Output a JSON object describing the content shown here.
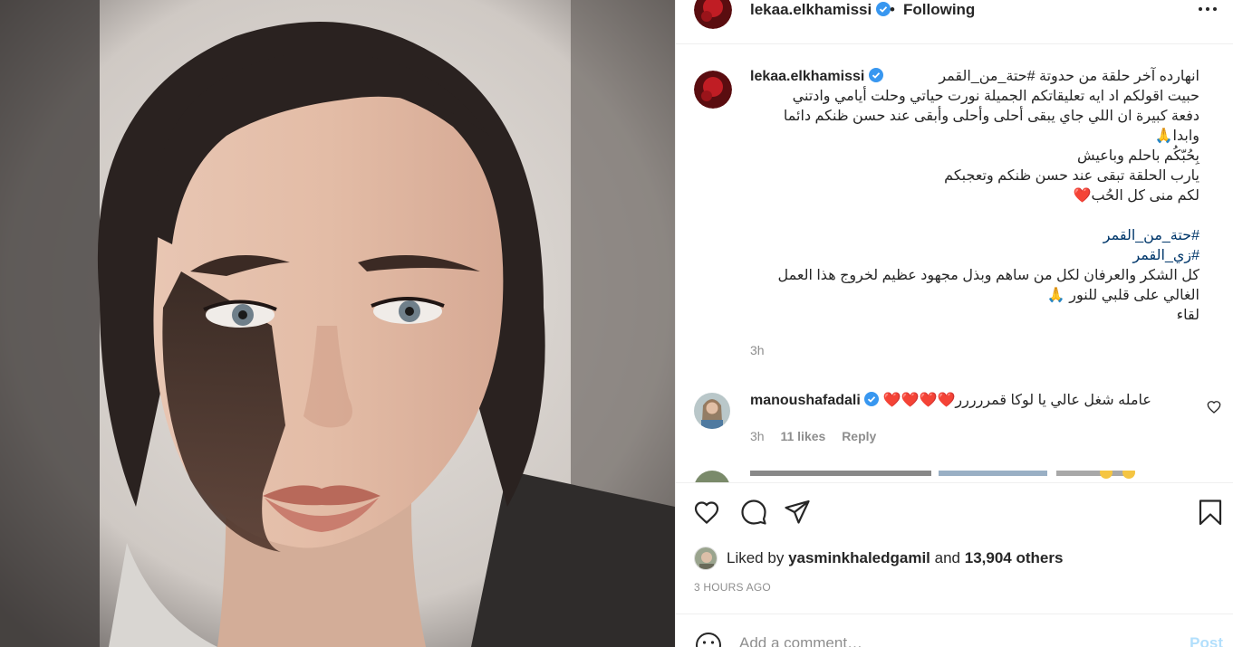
{
  "post": {
    "username": "lekaa.elkhamissi",
    "follow_status": "Following",
    "dot": "•"
  },
  "caption": {
    "username": "lekaa.elkhamissi",
    "lines": [
      "انهارده آخر حلقة من حدوتة #حتة_من_القمر",
      "حبيت اقولكم اد ايه تعليقاتكم الجميلة نورت حياتي وحلت أيامي وادتني",
      "دفعة كبيرة ان اللي جاي يبقى أحلى وأحلى وأبقى عند حسن ظنكم دائما",
      "وابدا🙏",
      "بِحُبّكُم باحلم وباعيش",
      "يارب الحلقة تبقى عند حسن ظنكم وتعجبكم",
      "لكم منى كل الحُب❤️",
      "",
      "#حتة_من_القمر",
      "#زي_القمر",
      "كل الشكر والعرفان لكل من ساهم وبذل مجهود عظيم لخروج هذا العمل",
      "الغالي على قلبي للنور 🙏",
      "لقاء"
    ],
    "time": "3h"
  },
  "comment": {
    "username": "manoushafadali",
    "text": "عامله شغل عالي يا لوكا قمررررر❤️❤️❤️❤️",
    "time": "3h",
    "likes": "11 likes",
    "reply": "Reply"
  },
  "likes": {
    "prefix": "Liked by",
    "user": "yasminkhaledgamil",
    "and": "and",
    "others": "13,904 others"
  },
  "timestamp": "3 HOURS AGO",
  "add_comment": {
    "placeholder": "Add a comment…",
    "post_label": "Post"
  },
  "colors": {
    "link": "#00376b",
    "secondary": "#8e8e8e",
    "verified": "#3897f0",
    "post_disabled": "#b2dffc"
  }
}
